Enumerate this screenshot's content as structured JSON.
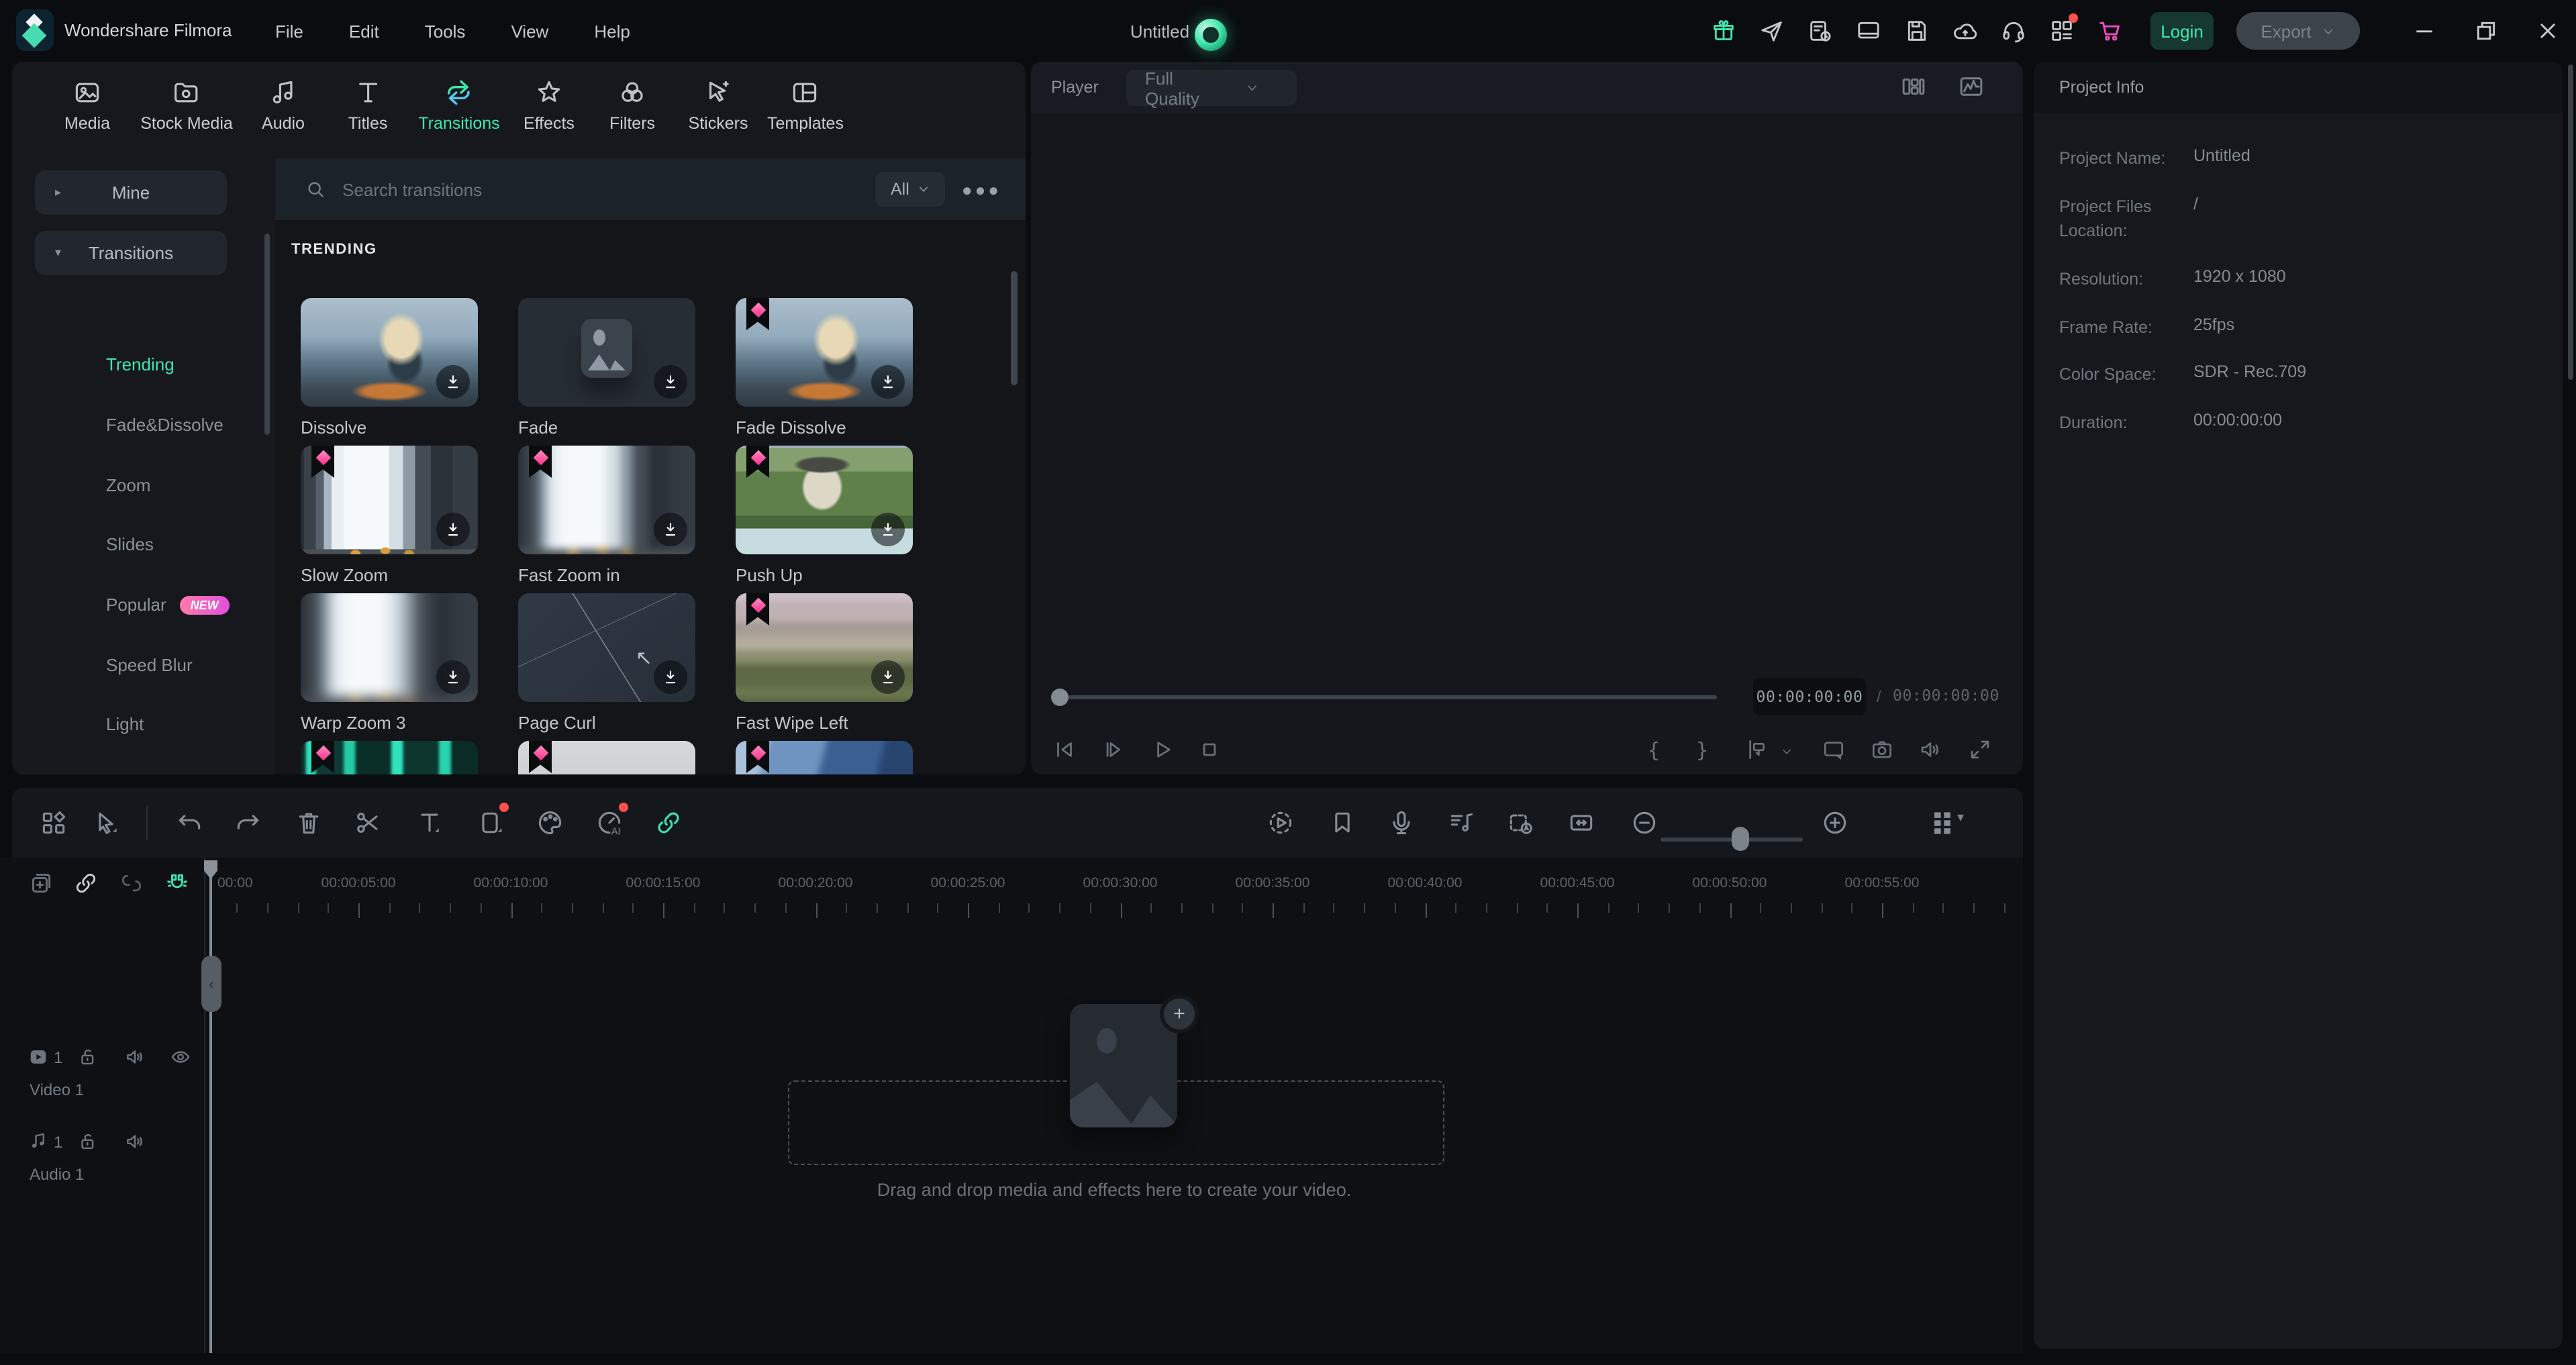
{
  "titlebar": {
    "app_name": "Wondershare Filmora",
    "menus": [
      "File",
      "Edit",
      "Tools",
      "View",
      "Help"
    ],
    "project_title": "Untitled",
    "icons": [
      "gift",
      "send",
      "backup",
      "screen",
      "save",
      "cloud",
      "support",
      "grid",
      "cart"
    ],
    "login_label": "Login",
    "export_label": "Export"
  },
  "media_tabs": [
    {
      "label": "Media",
      "icon": "media",
      "active": false
    },
    {
      "label": "Stock Media",
      "icon": "stock",
      "active": false
    },
    {
      "label": "Audio",
      "icon": "audio",
      "active": false
    },
    {
      "label": "Titles",
      "icon": "titles",
      "active": false
    },
    {
      "label": "Transitions",
      "icon": "transitions",
      "active": true
    },
    {
      "label": "Effects",
      "icon": "effects",
      "active": false
    },
    {
      "label": "Filters",
      "icon": "filters",
      "active": false
    },
    {
      "label": "Stickers",
      "icon": "stickers",
      "active": false
    },
    {
      "label": "Templates",
      "icon": "templates",
      "active": false
    }
  ],
  "sidebar": {
    "groups": [
      {
        "label": "Mine",
        "expanded": false
      },
      {
        "label": "Transitions",
        "expanded": true
      }
    ],
    "items": [
      {
        "label": "Trending",
        "active": true
      },
      {
        "label": "Fade&Dissolve",
        "active": false
      },
      {
        "label": "Zoom",
        "active": false
      },
      {
        "label": "Slides",
        "active": false
      },
      {
        "label": "Popular",
        "active": false,
        "badge": "NEW"
      },
      {
        "label": "Speed Blur",
        "active": false
      },
      {
        "label": "Light",
        "active": false
      }
    ]
  },
  "search": {
    "placeholder": "Search transitions",
    "filter_value": "All"
  },
  "library": {
    "section_title": "TRENDING",
    "cards": [
      {
        "name": "Dissolve",
        "art": "skier",
        "pro": false
      },
      {
        "name": "Fade",
        "art": "placeholder",
        "pro": false
      },
      {
        "name": "Fade Dissolve",
        "art": "skier",
        "pro": true
      },
      {
        "name": "Slow Zoom",
        "art": "city",
        "pro": true
      },
      {
        "name": "Fast Zoom in",
        "art": "cityblur",
        "pro": true
      },
      {
        "name": "Push Up",
        "art": "house",
        "pro": true
      },
      {
        "name": "Warp Zoom 3",
        "art": "citywarp",
        "pro": false
      },
      {
        "name": "Page Curl",
        "art": "curl",
        "pro": false
      },
      {
        "name": "Fast Wipe Left",
        "art": "wipe",
        "pro": true
      }
    ],
    "partial_row": [
      {
        "art": "glitch",
        "pro": true
      },
      {
        "art": "white",
        "pro": true
      },
      {
        "art": "blue",
        "pro": true
      }
    ]
  },
  "player": {
    "label": "Player",
    "quality": "Full Quality",
    "current_time": "00:00:00:00",
    "total_time": "00:00:00:00",
    "transport": [
      "step-back",
      "step-forward",
      "play",
      "stop"
    ],
    "tools": [
      "mark-in",
      "mark-out",
      "in-out-range",
      "fit-screen",
      "snapshot",
      "volume",
      "fullscreen"
    ]
  },
  "project_info": {
    "title": "Project Info",
    "rows": [
      {
        "label": "Project Name:",
        "value": "Untitled"
      },
      {
        "label": "Project Files Location:",
        "value": "/"
      },
      {
        "label": "Resolution:",
        "value": "1920 x 1080"
      },
      {
        "label": "Frame Rate:",
        "value": "25fps"
      },
      {
        "label": "Color Space:",
        "value": "SDR - Rec.709"
      },
      {
        "label": "Duration:",
        "value": "00:00:00:00"
      }
    ]
  },
  "toolbar": {
    "left_icons": [
      "shapes",
      "select",
      "undo",
      "redo",
      "trash",
      "split",
      "text",
      "crop",
      "palette",
      "speed-ai",
      "link"
    ],
    "right_icons": [
      "ai-portrait",
      "preview-render",
      "marker",
      "voiceover",
      "audio-stretch",
      "speed-clock",
      "auto-ripple",
      "zoom-out",
      "zoom-in",
      "track-manager"
    ]
  },
  "timeline": {
    "header_icons": [
      "add-to-timeline",
      "link-clips",
      "unlink-clips",
      "snap-magnet"
    ],
    "ruler": {
      "first_label": "00:00",
      "labels": [
        "00:00:05:00",
        "00:00:10:00",
        "00:00:15:00",
        "00:00:20:00",
        "00:00:25:00",
        "00:00:30:00",
        "00:00:35:00",
        "00:00:40:00",
        "00:00:45:00",
        "00:00:50:00",
        "00:00:55:00"
      ]
    },
    "tracks": [
      {
        "label": "Video 1",
        "count": "1",
        "type": "video"
      },
      {
        "label": "Audio 1",
        "count": "1",
        "type": "audio"
      }
    ],
    "dropzone_text": "Drag and drop media and effects here to create your video."
  },
  "colors": {
    "accent": "#3ee6ac",
    "pro_badge": "#ff4d9e",
    "notification": "#ff5050",
    "new_badge_start": "#ff7aa8",
    "new_badge_end": "#e14fe0"
  }
}
